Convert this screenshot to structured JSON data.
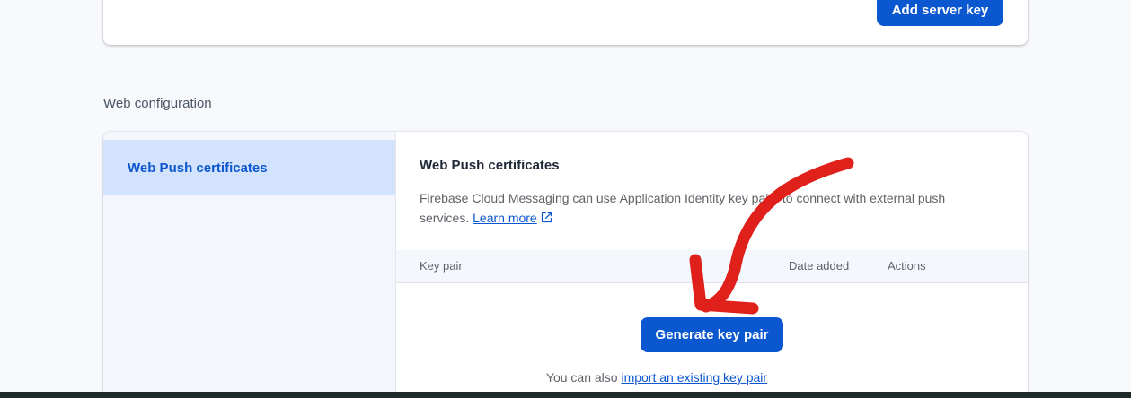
{
  "top_card": {
    "add_server_key_label": "Add server key"
  },
  "web_config": {
    "section_title": "Web configuration",
    "nav": {
      "items": [
        {
          "label": "Web Push certificates",
          "active": true
        }
      ]
    },
    "content": {
      "title": "Web Push certificates",
      "description": "Firebase Cloud Messaging can use Application Identity key pairs to connect with external push services.",
      "learn_more_label": "Learn more",
      "table_headers": {
        "key_pair": "Key pair",
        "date_added": "Date added",
        "actions": "Actions"
      },
      "generate_button_label": "Generate key pair",
      "import_prefix": "You can also ",
      "import_link_label": "import an existing key pair"
    }
  },
  "colors": {
    "accent": "#0b57d0",
    "annotation_arrow": "#e0201b"
  },
  "icons": {
    "external_link": "open-in-new-icon"
  }
}
